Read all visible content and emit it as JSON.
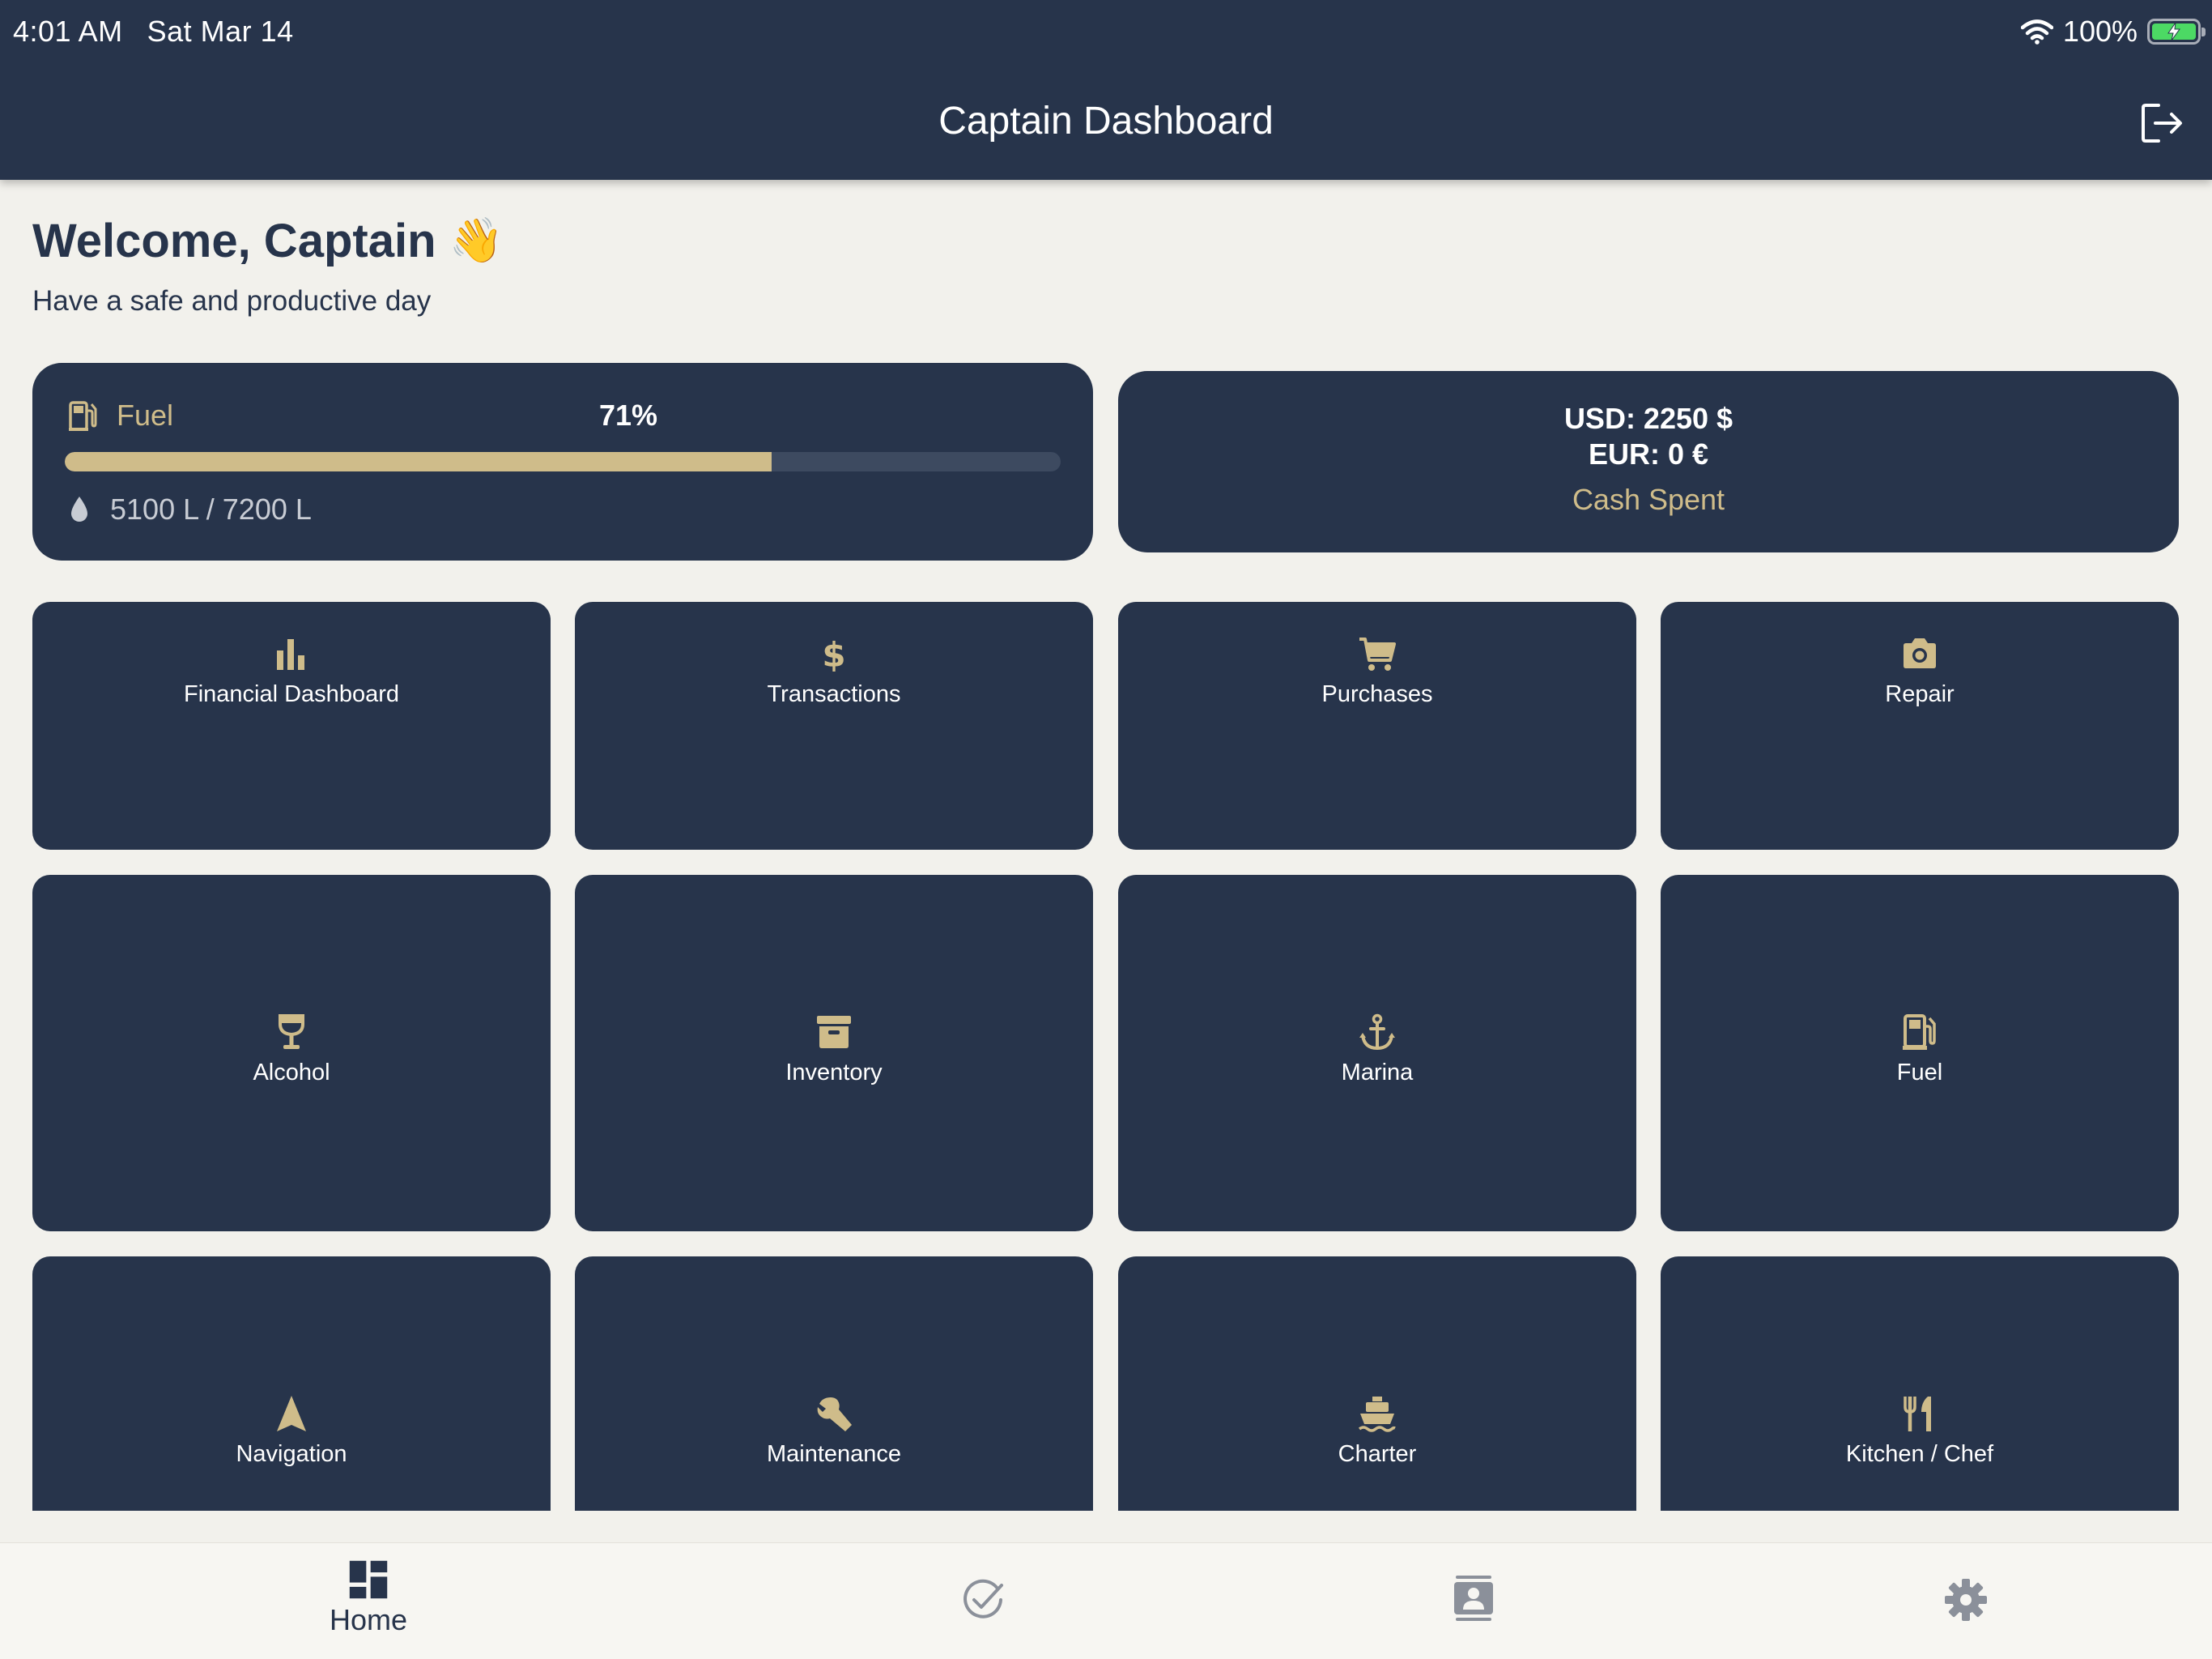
{
  "status_bar": {
    "time": "4:01 AM",
    "date": "Sat Mar 14",
    "battery": "100%"
  },
  "header": {
    "title": "Captain Dashboard"
  },
  "welcome": {
    "title": "Welcome, Captain",
    "emoji": "👋",
    "subtitle": "Have a safe and productive day"
  },
  "fuel_card": {
    "label": "Fuel",
    "percent_text": "71%",
    "percent": 0.71,
    "amount": "5100 L / 7200 L"
  },
  "cash_card": {
    "usd": "USD: 2250 $",
    "eur": "EUR: 0 €",
    "label": "Cash Spent"
  },
  "tiles": [
    {
      "label": "Financial Dashboard",
      "icon": "bar-chart-icon"
    },
    {
      "label": "Transactions",
      "icon": "dollar-icon"
    },
    {
      "label": "Purchases",
      "icon": "cart-icon"
    },
    {
      "label": "Repair",
      "icon": "camera-icon"
    },
    {
      "label": "Alcohol",
      "icon": "glass-icon"
    },
    {
      "label": "Inventory",
      "icon": "archive-box-icon"
    },
    {
      "label": "Marina",
      "icon": "anchor-icon"
    },
    {
      "label": "Fuel",
      "icon": "gas-pump-icon"
    },
    {
      "label": "Navigation",
      "icon": "navigation-arrow-icon"
    },
    {
      "label": "Maintenance",
      "icon": "wrench-icon"
    },
    {
      "label": "Charter",
      "icon": "ship-icon"
    },
    {
      "label": "Kitchen / Chef",
      "icon": "utensils-icon"
    }
  ],
  "tabbar": {
    "home_label": "Home"
  },
  "colors": {
    "navy": "#27344b",
    "gold": "#cfbc8a",
    "background": "#f2f1ec"
  }
}
